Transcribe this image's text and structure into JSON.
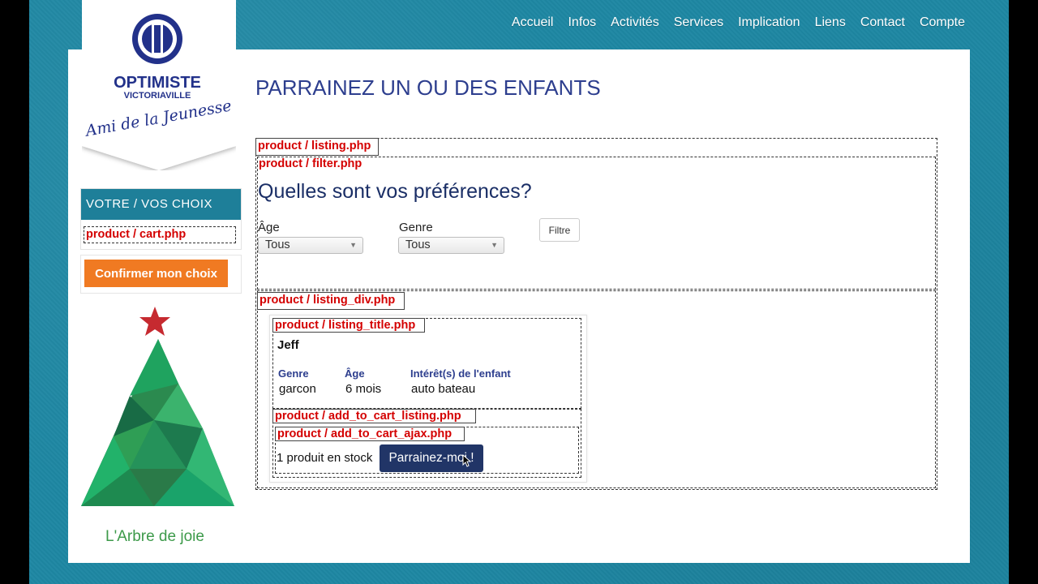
{
  "nav": {
    "items": [
      "Accueil",
      "Infos",
      "Activités",
      "Services",
      "Implication",
      "Liens",
      "Contact",
      "Compte"
    ]
  },
  "logo": {
    "name": "OPTIMISTE",
    "city": "VICTORIAVILLE",
    "tagline": "Ami de la Jeunesse"
  },
  "sidebar": {
    "choice_title": "VOTRE / VOS CHOIX",
    "cart_debug": "product / cart.php",
    "confirm_label": "Confirmer mon choix",
    "tree_label": "L'Arbre de joie"
  },
  "page": {
    "title": "PARRAINEZ UN OU DES ENFANTS"
  },
  "debug": {
    "listing": "product / listing.php",
    "filter": "product / filter.php",
    "listing_div": "product / listing_div.php",
    "listing_title": "product / listing_title.php",
    "add_to_cart_listing": "product / add_to_cart_listing.php",
    "add_to_cart_ajax": "product / add_to_cart_ajax.php"
  },
  "filter": {
    "heading": "Quelles sont vos préférences?",
    "age_label": "Âge",
    "age_value": "Tous",
    "genre_label": "Genre",
    "genre_value": "Tous",
    "button": "Filtre"
  },
  "listing": {
    "name": "Jeff",
    "headers": {
      "genre": "Genre",
      "age": "Âge",
      "interests": "Intérêt(s) de l'enfant"
    },
    "values": {
      "genre": "garcon",
      "age": "6 mois",
      "interests": "auto bateau"
    },
    "stock": "1 produit en stock",
    "cta": "Parrainez-moi !"
  },
  "colors": {
    "background": "#1e87a3",
    "title_blue": "#2d3e8e",
    "debug_red": "#d40000",
    "confirm_orange": "#f07a22",
    "cta_navy": "#213567"
  }
}
